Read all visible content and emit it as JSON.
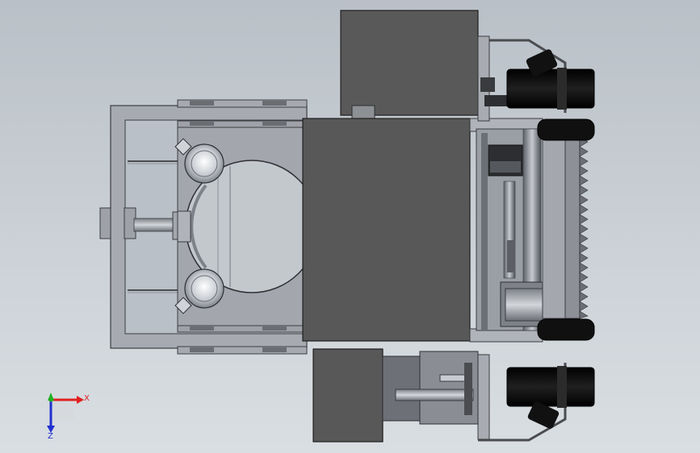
{
  "triad": {
    "x_label": "X",
    "z_label": "Z",
    "x_color": "#e02020",
    "y_color": "#20b020",
    "z_color": "#2030d0"
  },
  "colors": {
    "background_top": "#b9c0c7",
    "background_bottom": "#d9dee2",
    "dark_panel": "#5a5a5a",
    "frame_gray": "#a9acb3",
    "tire_black": "#101010"
  }
}
